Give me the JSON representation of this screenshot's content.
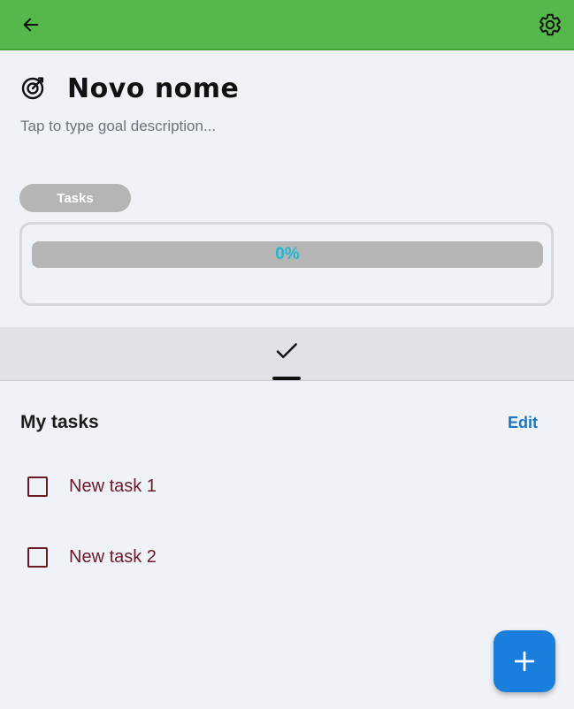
{
  "appbar": {
    "back_icon": "arrow-left-icon",
    "settings_icon": "gear-icon",
    "color": "#55b84a"
  },
  "goal": {
    "icon": "target-icon",
    "title": "Novo nome",
    "description_placeholder": "Tap to type goal description..."
  },
  "chip": {
    "label": "Tasks"
  },
  "progress": {
    "value": 0,
    "label": "0%",
    "color": "#1fb8d3"
  },
  "tabs": {
    "active_icon": "check-icon"
  },
  "tasks_section": {
    "title": "My tasks",
    "edit_label": "Edit",
    "items": [
      {
        "label": "New task 1",
        "checked": false
      },
      {
        "label": "New task 2",
        "checked": false
      }
    ]
  },
  "fab": {
    "icon": "plus-icon",
    "color": "#1a7fdc"
  }
}
